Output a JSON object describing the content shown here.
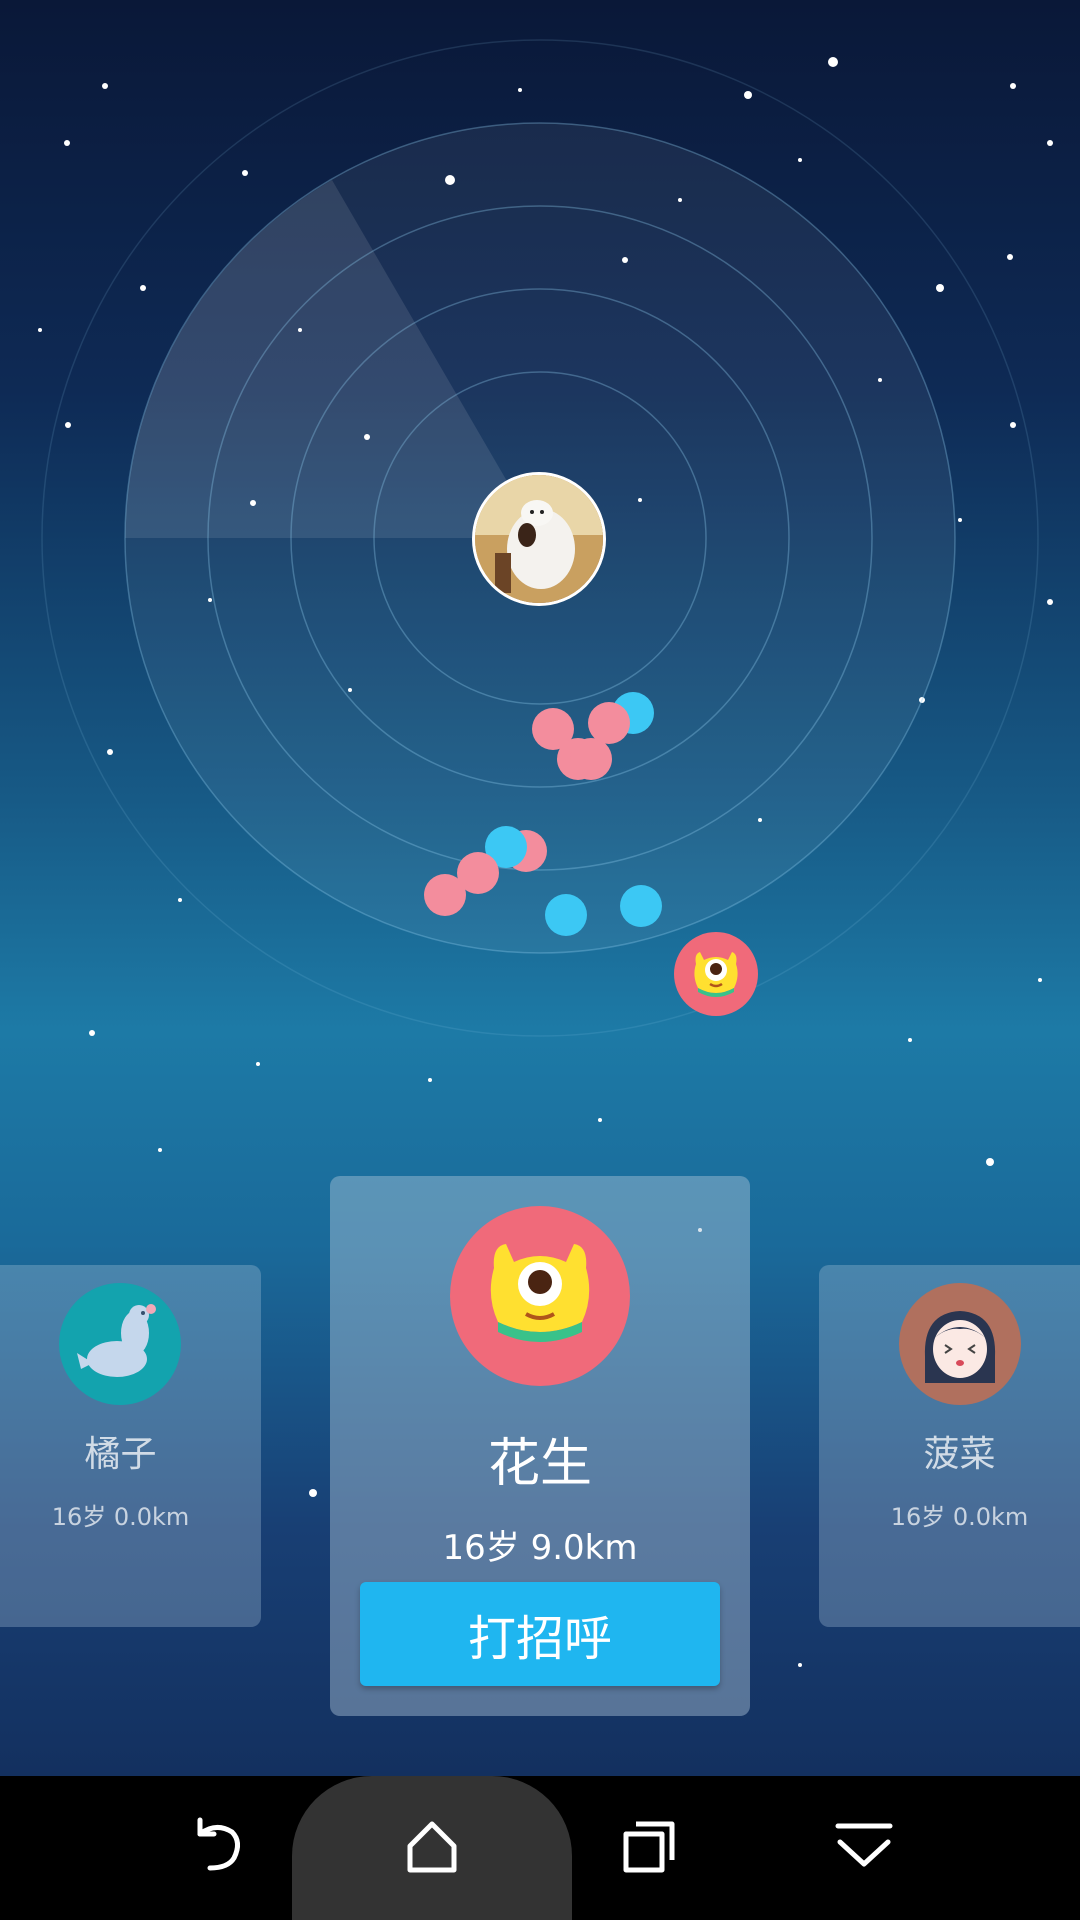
{
  "current_user": {
    "avatar_icon": "user-avatar-icon"
  },
  "radar": {
    "blips": [
      {
        "color": "pink"
      },
      {
        "color": "pink"
      },
      {
        "color": "pink"
      },
      {
        "color": "pink"
      },
      {
        "color": "blue"
      },
      {
        "color": "blue"
      },
      {
        "color": "pink"
      },
      {
        "color": "pink"
      },
      {
        "color": "pink"
      },
      {
        "color": "blue"
      },
      {
        "color": "blue"
      }
    ],
    "highlighted_user_icon": "yellow-monster-icon"
  },
  "cards": {
    "left": {
      "name": "橘子",
      "info": "16岁 0.0km",
      "avatar_icon": "seal-icon"
    },
    "center": {
      "name": "花生",
      "info": "16岁 9.0km",
      "avatar_icon": "yellow-monster-icon",
      "greet_label": "打招呼"
    },
    "right": {
      "name": "菠菜",
      "info": "16岁 0.0km",
      "avatar_icon": "girl-face-icon"
    }
  },
  "navbar": {
    "back_icon": "back-icon",
    "home_icon": "home-icon",
    "recent_icon": "recent-apps-icon",
    "collapse_icon": "collapse-icon"
  },
  "colors": {
    "accent_button": "#1fb6f0",
    "pink_blip": "#f38d9d",
    "blue_blip": "#3cc8f4",
    "avatar_pink": "#f06a7a"
  }
}
